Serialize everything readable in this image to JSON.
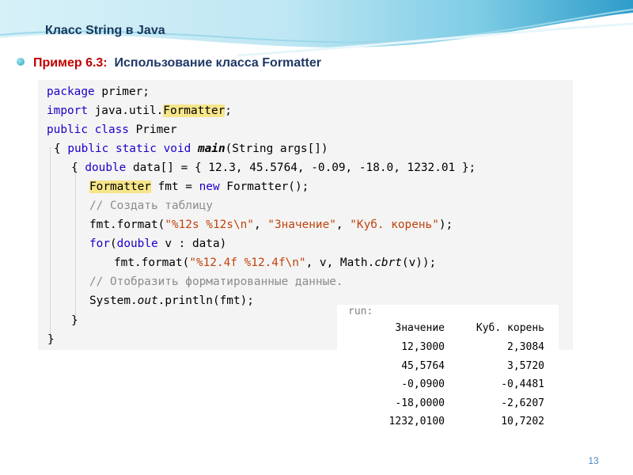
{
  "slide": {
    "title": "Класс String в Java",
    "example_label": "Пример 6.3:",
    "example_title": "Использование класса Formatter",
    "page_number": "13"
  },
  "code": {
    "line1_kw": "package",
    "line1_rest": " primer;",
    "line2_kw": "import",
    "line2_mid": " java.util.",
    "line2_hl": "Formatter",
    "line2_end": ";",
    "line3_kw": "public class",
    "line3_rest": " Primer",
    "line4_open": "{ ",
    "line4_kw": "public static void",
    "line4_sp": " ",
    "line4_method": "main",
    "line4_rest": "(String args[])",
    "line5_open": "{ ",
    "line5_kw": "double",
    "line5_rest": " data[] = { 12.3, 45.5764, -0.09, -18.0, 1232.01 };",
    "line6_hl": "Formatter",
    "line6_mid": " fmt = ",
    "line6_kw": "new",
    "line6_rest": " Formatter();",
    "line7_comment": "// Создать таблицу",
    "line8_pre": "fmt.format(",
    "line8_s1": "\"%12s %12s\\n\"",
    "line8_c1": ", ",
    "line8_s2": "\"Значение\"",
    "line8_c2": ", ",
    "line8_s3": "\"Куб. корень\"",
    "line8_end": ");",
    "line9_kw1": "for",
    "line9_mid1": "(",
    "line9_kw2": "double",
    "line9_rest": " v : data)",
    "line10_pre": "fmt.format(",
    "line10_s1": "\"%12.4f %12.4f\\n\"",
    "line10_mid": ", v, Math.",
    "line10_method": "cbrt",
    "line10_end": "(v));",
    "line11_comment": "// Отобразить форматированные данные.",
    "line12_pre": "System.",
    "line12_field": "out",
    "line12_rest": ".println(fmt);",
    "line13": "}",
    "line14": "}"
  },
  "output": {
    "run_label": "run:",
    "headers": [
      "Значение",
      "Куб. корень"
    ],
    "rows": [
      [
        "12,3000",
        "2,3084"
      ],
      [
        "45,5764",
        "3,5720"
      ],
      [
        "-0,0900",
        "-0,4481"
      ],
      [
        "-18,0000",
        "-2,6207"
      ],
      [
        "1232,0100",
        "10,7202"
      ]
    ]
  }
}
